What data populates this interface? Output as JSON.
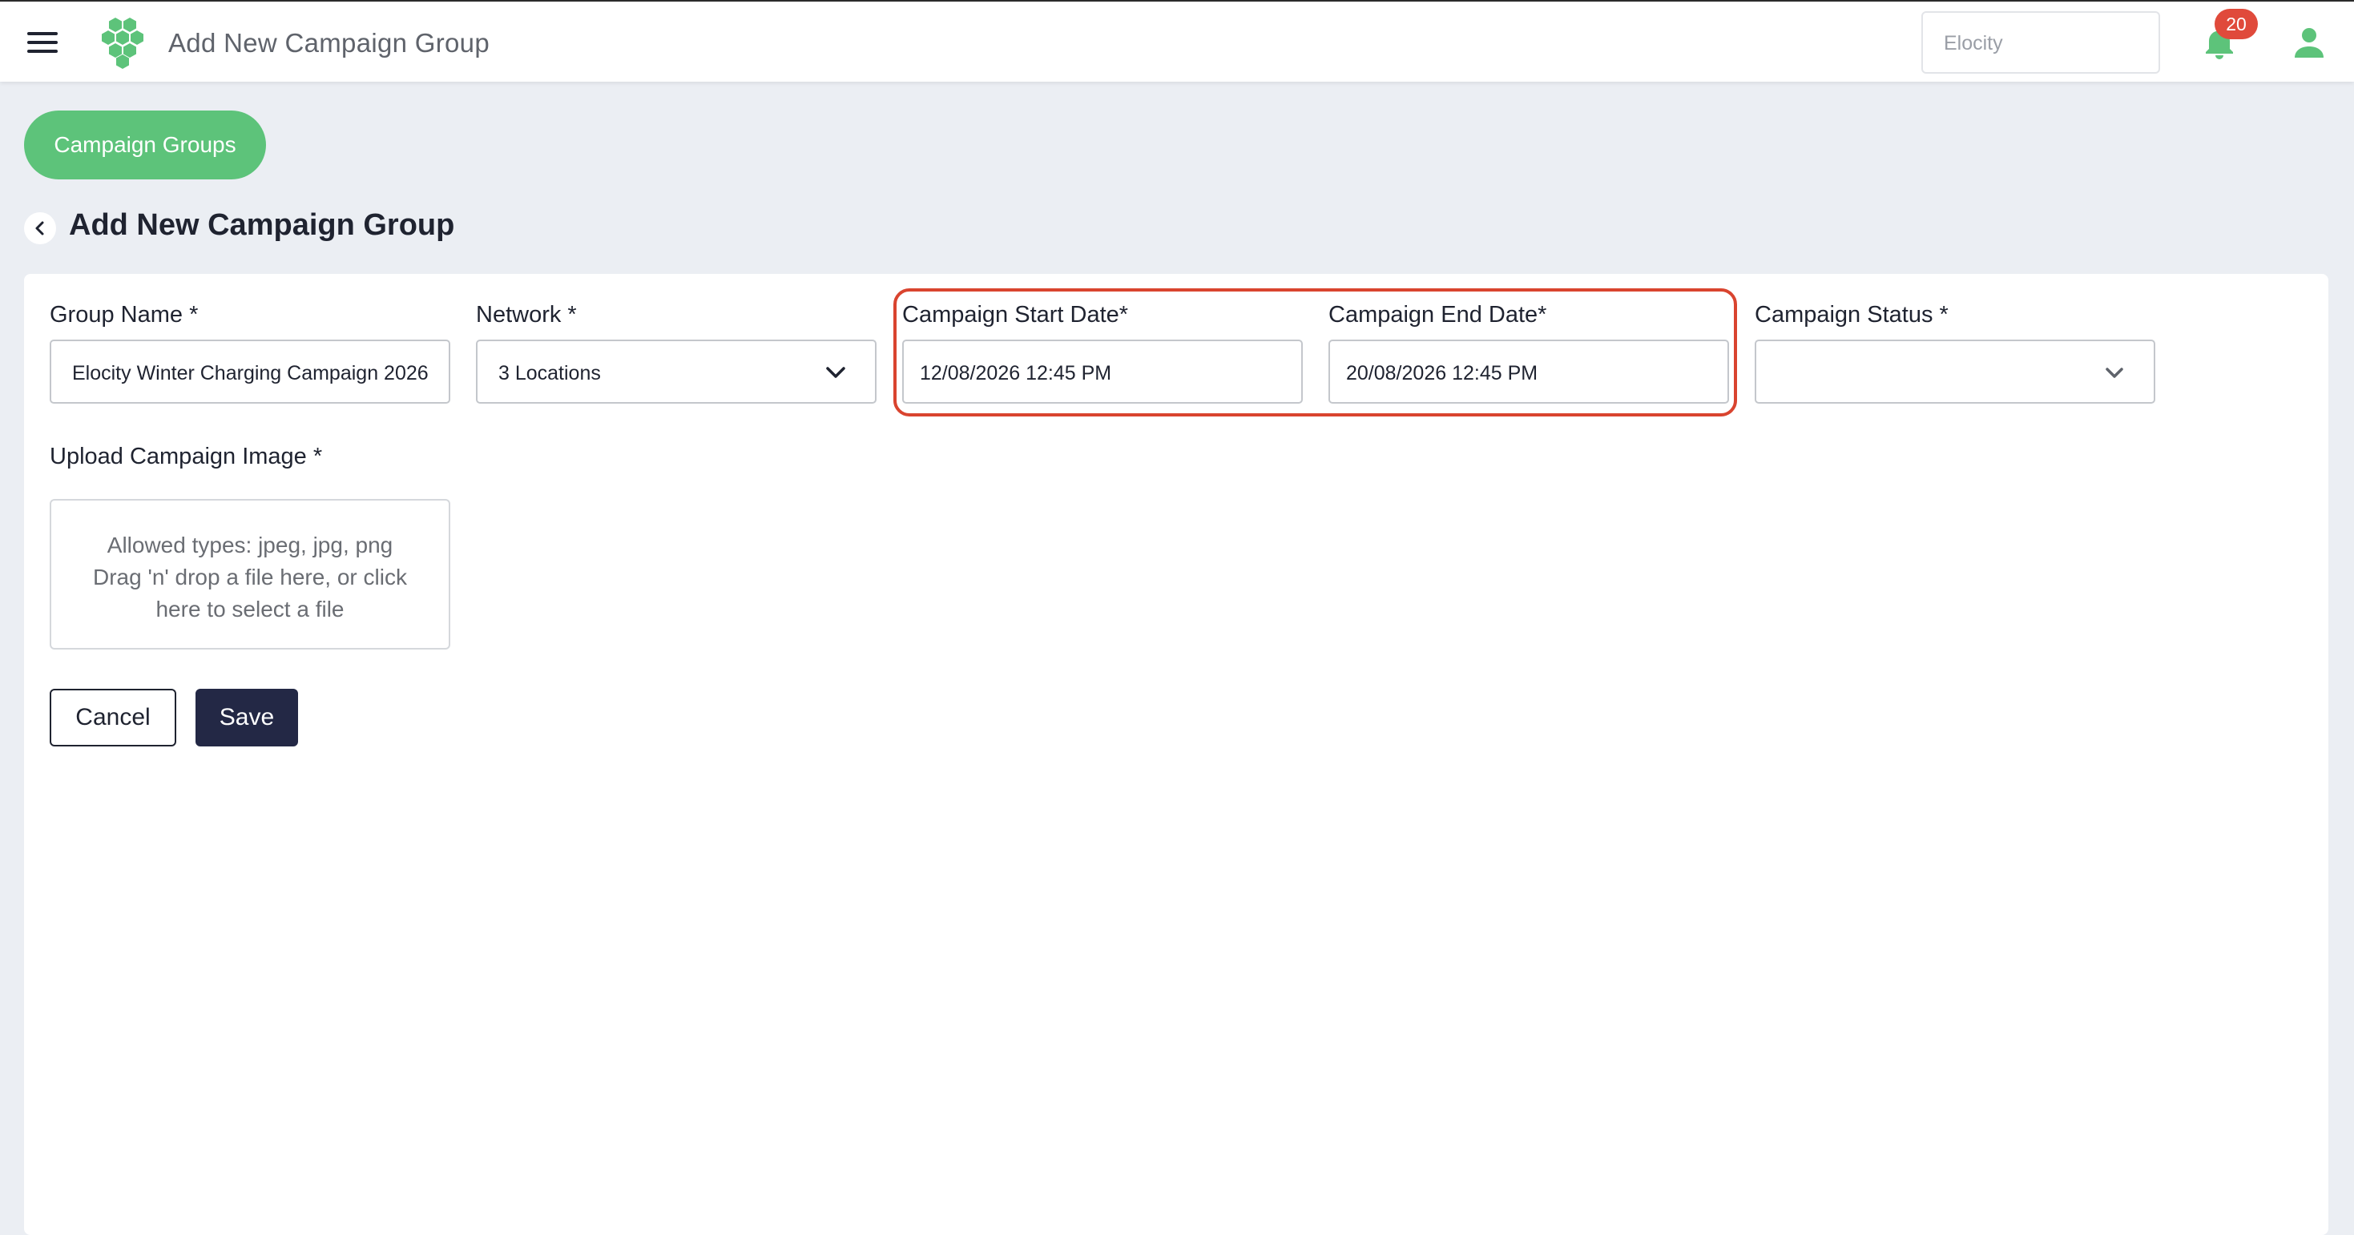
{
  "header": {
    "title": "Add New Campaign Group",
    "org_selector": "Elocity",
    "notification_count": "20",
    "brand_color": "#5dc37a"
  },
  "breadcrumb": {
    "pill_label": "Campaign Groups"
  },
  "page": {
    "title": "Add New Campaign Group"
  },
  "form": {
    "group_name": {
      "label": "Group Name *",
      "value": "Elocity Winter Charging Campaign 2026"
    },
    "network": {
      "label": "Network *",
      "value": "3 Locations"
    },
    "start_date": {
      "label": "Campaign Start Date*",
      "value": "12/08/2026 12:45 PM"
    },
    "end_date": {
      "label": "Campaign End Date*",
      "value": "20/08/2026 12:45 PM"
    },
    "status": {
      "label": "Campaign Status *",
      "value": ""
    },
    "upload": {
      "label": "Upload Campaign Image *",
      "line1": "Allowed types: jpeg, jpg, png",
      "line2": "Drag 'n' drop a file here, or click",
      "line3": "here to select a file"
    },
    "cancel_label": "Cancel",
    "save_label": "Save"
  },
  "icons": {
    "menu": "hamburger-menu-icon",
    "logo": "hexagon-cluster-logo",
    "bell": "bell-icon",
    "user": "user-icon",
    "back": "chevron-left-icon",
    "dropdown": "chevron-down-icon"
  },
  "colors": {
    "highlight": "#d9442f",
    "badge": "#e04a3b",
    "save_button": "#232845",
    "background": "#ebeef3"
  }
}
